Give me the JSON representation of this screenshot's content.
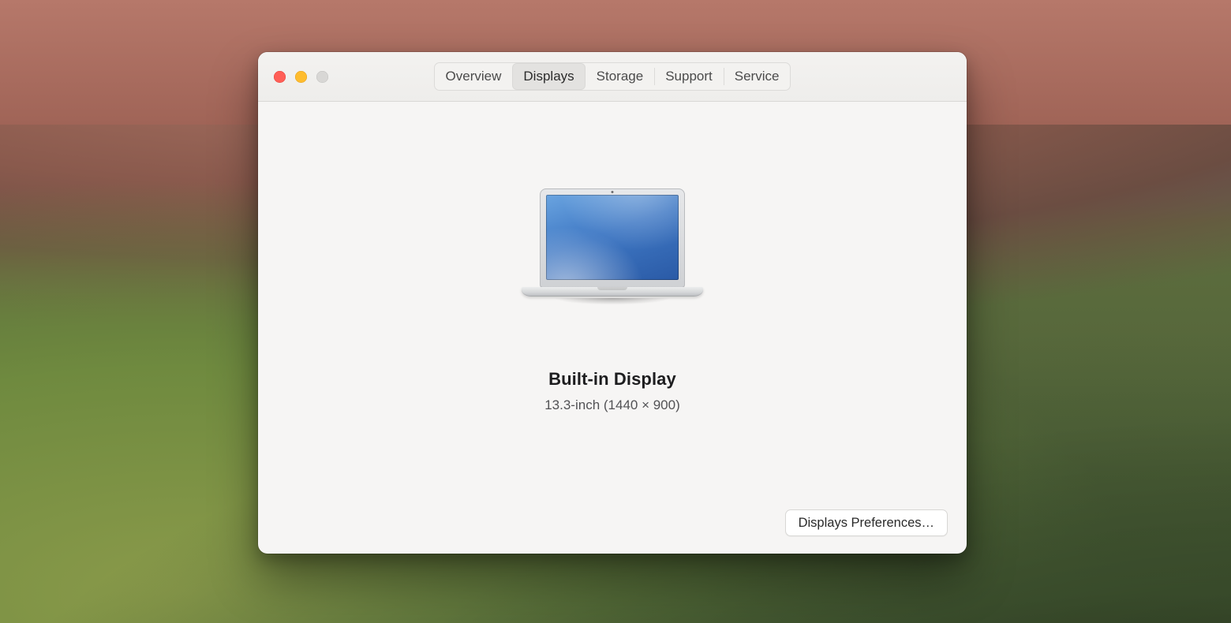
{
  "tabs": {
    "overview": "Overview",
    "displays": "Displays",
    "storage": "Storage",
    "support": "Support",
    "service": "Service",
    "active": "displays"
  },
  "display": {
    "title": "Built-in Display",
    "details": "13.3-inch (1440 × 900)"
  },
  "buttons": {
    "displays_preferences": "Displays Preferences…"
  }
}
